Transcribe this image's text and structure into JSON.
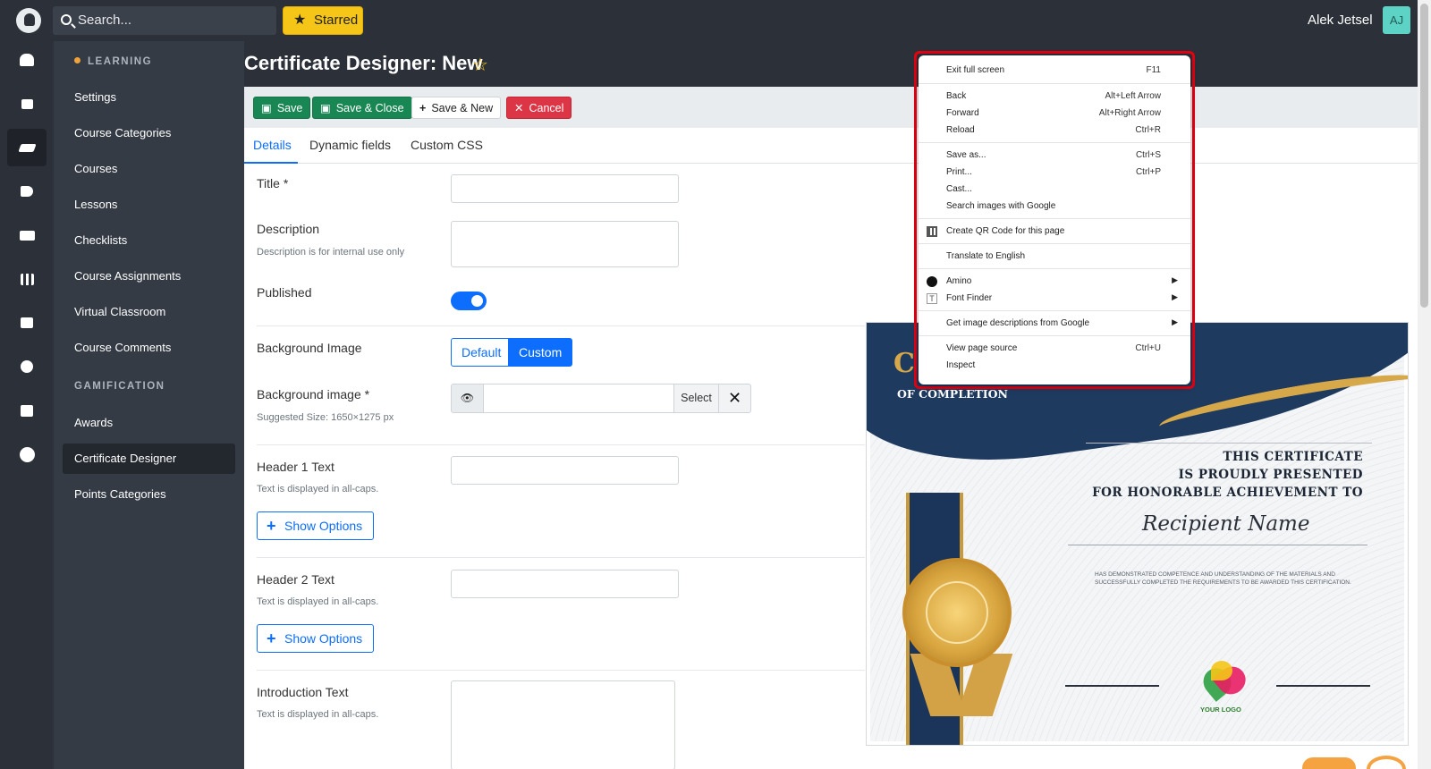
{
  "topbar": {
    "search_placeholder": "Search...",
    "starred_label": "Starred",
    "user_name": "Alek Jetsel",
    "user_initials": "AJ"
  },
  "rail": {
    "icons": [
      "users-icon",
      "dashboard-icon",
      "graduation-cap-icon",
      "megaphone-icon",
      "camera-icon",
      "chart-icon",
      "chat-icon",
      "palette-icon",
      "calendar-icon",
      "gear-icon"
    ],
    "active_icon": "graduation-cap-icon"
  },
  "subnav": {
    "learning_head": "LEARNING",
    "learning_items": [
      "Settings",
      "Course Categories",
      "Courses",
      "Lessons",
      "Checklists",
      "Course Assignments",
      "Virtual Classroom",
      "Course Comments"
    ],
    "gamification_head": "GAMIFICATION",
    "gamification_items": [
      "Awards",
      "Certificate Designer",
      "Points Categories"
    ],
    "active_item": "Certificate Designer"
  },
  "page": {
    "title": "Certificate Designer: New"
  },
  "toolbar": {
    "save": "Save",
    "save_close": "Save & Close",
    "save_new": "Save & New",
    "cancel": "Cancel"
  },
  "tabs": [
    "Details",
    "Dynamic fields",
    "Custom CSS"
  ],
  "active_tab": "Details",
  "form": {
    "title_label": "Title *",
    "description_label": "Description",
    "description_help": "Description is for internal use only",
    "published_label": "Published",
    "published_value": true,
    "background_image_label": "Background Image",
    "bg_option_default": "Default",
    "bg_option_custom": "Custom",
    "bg_option_selected": "Custom",
    "background_image_file_label": "Background image *",
    "background_image_help": "Suggested Size: 1650×1275 px",
    "select_button": "Select",
    "header1_label": "Header 1 Text",
    "header1_help": "Text is displayed in all-caps.",
    "header2_label": "Header 2 Text",
    "header2_help": "Text is displayed in all-caps.",
    "intro_label": "Introduction Text",
    "intro_help": "Text is displayed in all-caps.",
    "show_options": "Show Options"
  },
  "certificate": {
    "of_completion": "OF COMPLETION",
    "presented_line1": "THIS CERTIFICATE",
    "presented_line2": "IS PROUDLY PRESENTED",
    "presented_line3": "FOR HONORABLE ACHIEVEMENT TO",
    "recipient": "Recipient Name",
    "body": "HAS DEMONSTRATED COMPETENCE AND UNDERSTANDING OF THE MATERIALS AND SUCCESSFULLY COMPLETED THE REQUIREMENTS TO BE AWARDED THIS CERTIFICATION.",
    "logo_text": "YOUR LOGO"
  },
  "context_menu": {
    "items": [
      {
        "label": "Exit full screen",
        "shortcut": "F11"
      },
      {
        "label": "Back",
        "shortcut": "Alt+Left Arrow"
      },
      {
        "label": "Forward",
        "shortcut": "Alt+Right Arrow"
      },
      {
        "label": "Reload",
        "shortcut": "Ctrl+R"
      },
      {
        "label": "Save as...",
        "shortcut": "Ctrl+S"
      },
      {
        "label": "Print...",
        "shortcut": "Ctrl+P"
      },
      {
        "label": "Cast...",
        "shortcut": ""
      },
      {
        "label": "Search images with Google",
        "shortcut": ""
      },
      {
        "label": "Create QR Code for this page",
        "shortcut": ""
      },
      {
        "label": "Translate to English",
        "shortcut": ""
      },
      {
        "label": "Amino",
        "shortcut": ""
      },
      {
        "label": "Font Finder",
        "shortcut": ""
      },
      {
        "label": "Get image descriptions from Google",
        "shortcut": ""
      },
      {
        "label": "View page source",
        "shortcut": "Ctrl+U"
      },
      {
        "label": "Inspect",
        "shortcut": ""
      }
    ]
  },
  "colors": {
    "primary": "#0d6efd",
    "success": "#198754",
    "danger": "#dc3545",
    "warning": "#f5c518",
    "sidebar": "#2b3039",
    "highlight_frame": "#e60012"
  }
}
